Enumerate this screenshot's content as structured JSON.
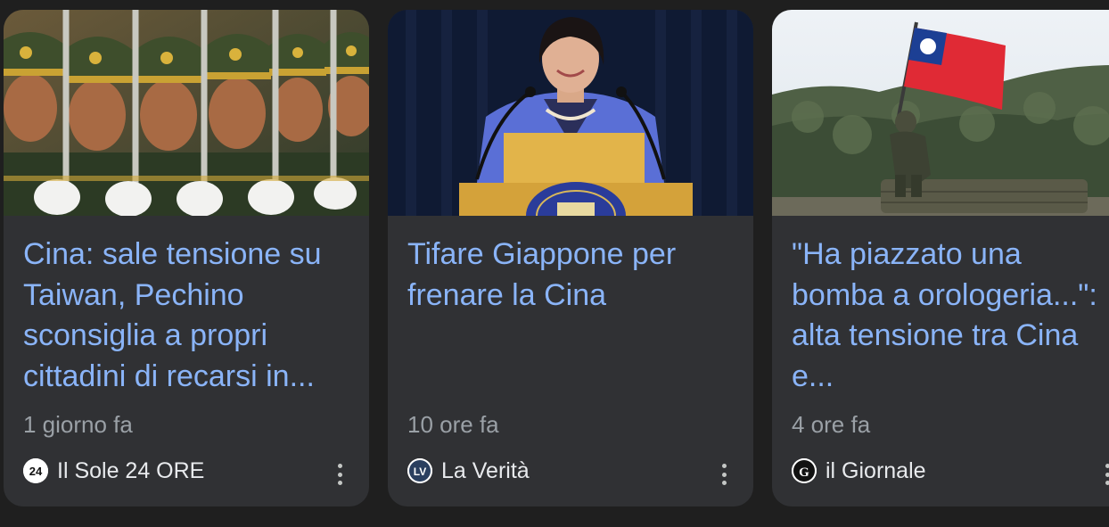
{
  "cards": [
    {
      "headline": "Cina: sale tensione su Taiwan, Pechino sconsiglia a propri cittadini di recarsi in...",
      "time": "1 giorno fa",
      "source": "Il Sole 24 ORE",
      "logo_text": "24",
      "image": "soldiers-parade-photo"
    },
    {
      "headline": "Tifare Giappone per frenare la Cina",
      "time": "10 ore fa",
      "source": "La Verità",
      "logo_text": "LV",
      "image": "politician-at-podium-photo"
    },
    {
      "headline": "\"Ha piazzato una bomba a orologeria...\": alta tensione tra Cina e...",
      "time": "4 ore fa",
      "source": "il Giornale",
      "logo_text": "G",
      "image": "soldier-with-taiwan-flag-photo"
    }
  ],
  "icons": {
    "menu": "more-vert-icon"
  },
  "colors": {
    "background": "#1f1f1f",
    "card": "#303134",
    "headline": "#8ab4f8",
    "meta": "#9aa0a6",
    "source": "#e8eaed"
  }
}
